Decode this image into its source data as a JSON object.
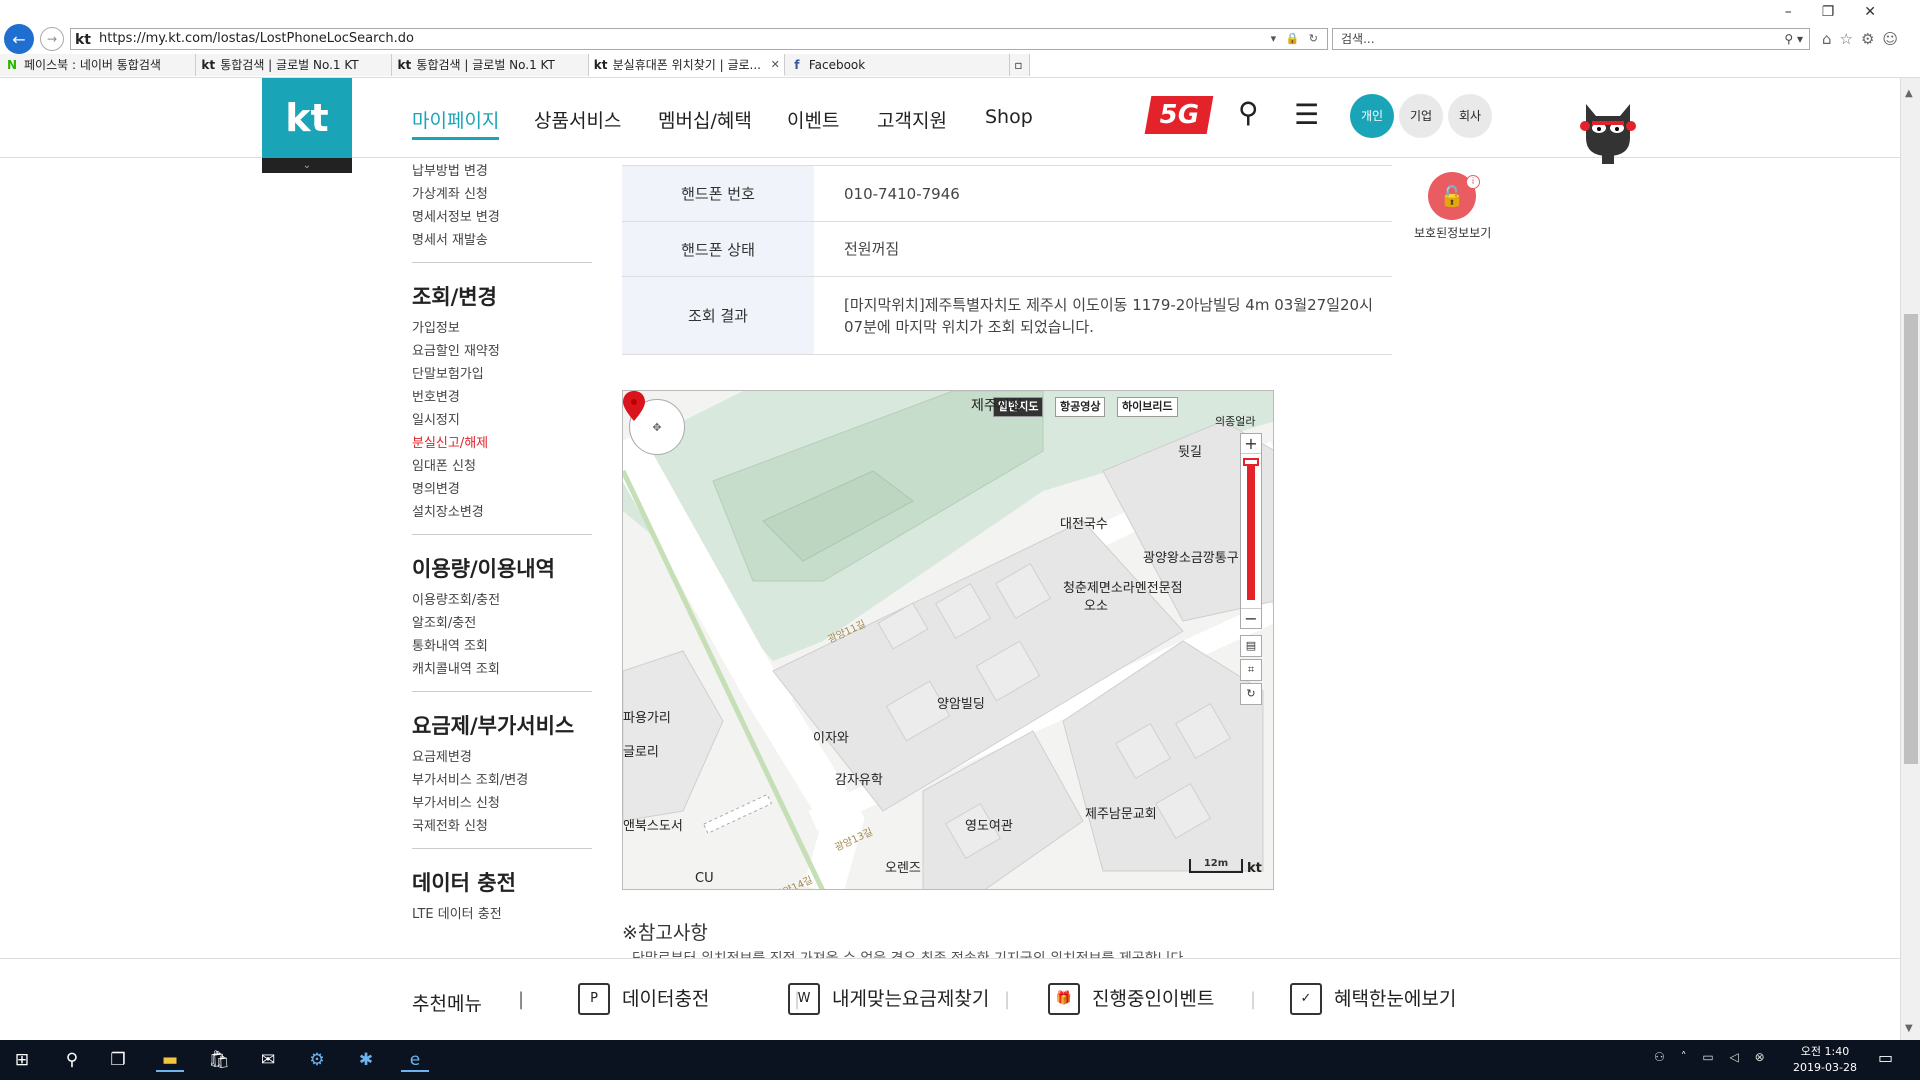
{
  "browser": {
    "url": "https://my.kt.com/lostas/LostPhoneLocSearch.do",
    "search_placeholder": "검색...",
    "tabs": [
      {
        "favicon": "N",
        "favicon_color": "#2db400",
        "label": "페이스북 : 네이버 통합검색"
      },
      {
        "favicon": "kt",
        "favicon_color": "#222222",
        "label": "통합검색 | 글로벌 No.1 KT"
      },
      {
        "favicon": "kt",
        "favicon_color": "#222222",
        "label": "통합검색 | 글로벌 No.1 KT"
      },
      {
        "favicon": "kt",
        "favicon_color": "#222222",
        "label": "분실휴대폰 위치찾기 | 글로...",
        "active": true
      },
      {
        "favicon": "f",
        "favicon_color": "#3b5998",
        "label": "Facebook"
      }
    ]
  },
  "header": {
    "logo": "kt",
    "nav": [
      "마이페이지",
      "상품서비스",
      "멤버십/혜택",
      "이벤트",
      "고객지원",
      "Shop"
    ],
    "five_g": "5G",
    "segments": [
      "개인",
      "기업",
      "회사"
    ]
  },
  "lnb": {
    "top_links": [
      "납부방법 변경",
      "가상계좌 신청",
      "명세서정보 변경",
      "명세서 재발송"
    ],
    "sections": [
      {
        "title": "조회/변경",
        "links": [
          "가입정보",
          "요금할인 재약정",
          "단말보험가입",
          "번호변경",
          "일시정지",
          "분실신고/해제",
          "임대폰 신청",
          "명의변경",
          "설치장소변경"
        ]
      },
      {
        "title": "이용량/이용내역",
        "links": [
          "이용량조회/충전",
          "알조회/충전",
          "통화내역 조회",
          "캐치콜내역 조회"
        ]
      },
      {
        "title": "요금제/부가서비스",
        "links": [
          "요금제변경",
          "부가서비스 조회/변경",
          "부가서비스 신청",
          "국제전화 신청"
        ]
      },
      {
        "title": "데이터 충전",
        "links": [
          "LTE 데이터 충전"
        ]
      }
    ],
    "active_link": "분실신고/해제"
  },
  "info": {
    "rows": [
      {
        "label": "핸드폰 번호",
        "value": "010-7410-7946"
      },
      {
        "label": "핸드폰 상태",
        "value": "전원꺼짐"
      },
      {
        "label": "조회 결과",
        "value": "[마지막위치]제주특별자치도 제주시 이도이동 1179-2아남빌딩 4m 03월27일20시07분에 마지막 위치가 조회 되었습니다."
      }
    ]
  },
  "map": {
    "view_buttons": [
      "일반지도",
      "항공영상",
      "하이브리드"
    ],
    "labels": {
      "city_hall": "제주시청",
      "dwitgil": "뒷길",
      "daejeon": "대전국수",
      "gwangyang": "광양왕소금깡통구",
      "cheongchun": "청춘제면소라멘전문점",
      "oso": "오소",
      "yangam": "양암빌딩",
      "ijawa": "이자와",
      "gamja": "감자유학",
      "yeongdo": "영도여관",
      "nammun": "제주남문교회",
      "orenz": "오렌즈",
      "cu": "CU",
      "bookstore": "앤북스도서",
      "left1": "파용가리",
      "left2": "글로리",
      "uijong": "의종얼라",
      "road1": "광양11길",
      "road2": "광양13길",
      "road3": "광양14길"
    },
    "scale": "12m",
    "logo": "kt"
  },
  "notes": {
    "title": "※참고사항",
    "line": "단말로부터 위치정보를 직접 가져올 수 없을 경우 최종 접속한 기지국의 위치정보를 제공합니다."
  },
  "protected": {
    "label": "보호된정보보기"
  },
  "reco": {
    "title": "추천메뉴",
    "items": [
      "데이터충전",
      "내게맞는요금제찾기",
      "진행중인이벤트",
      "혜택한눈에보기"
    ]
  },
  "taskbar": {
    "time": "오전 1:40",
    "date": "2019-03-28"
  }
}
